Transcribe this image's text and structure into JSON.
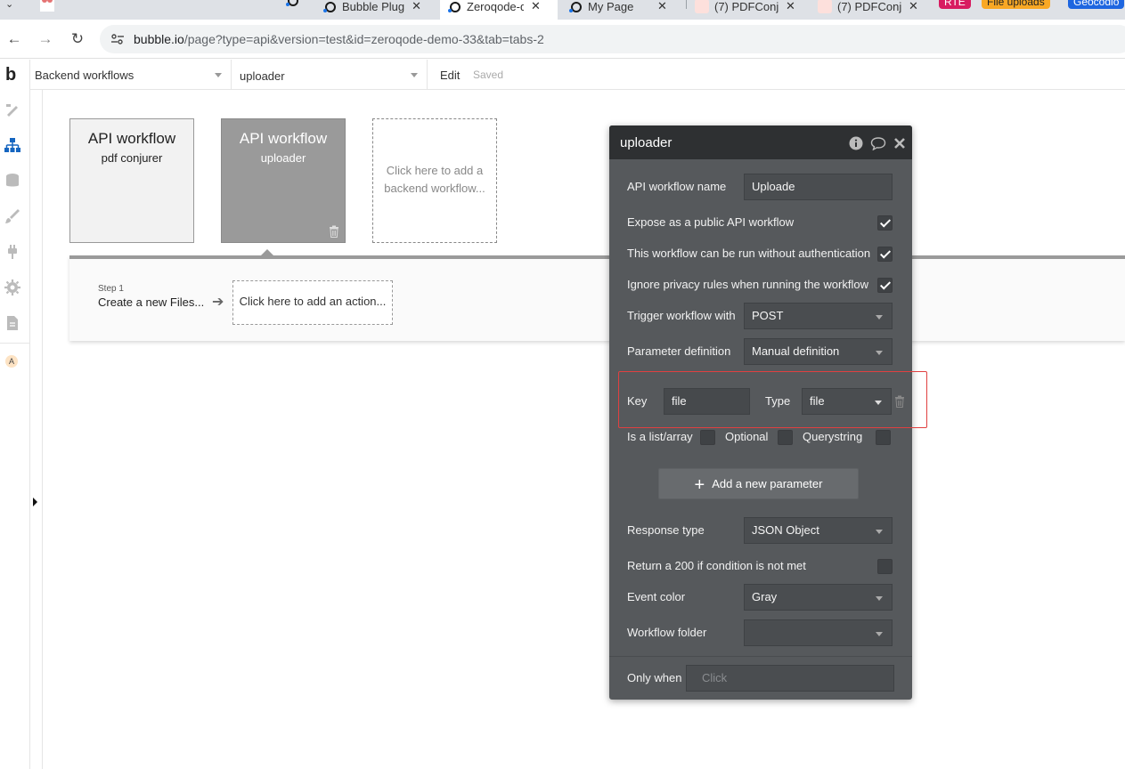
{
  "browser": {
    "tabs": [
      {
        "title": "Bubble Plug",
        "color": "#1a73e8"
      },
      {
        "title": "Zeroqode-d",
        "color": "#1a73e8"
      },
      {
        "title": "My Page",
        "color": "#1a73e8"
      },
      {
        "title": "(7) PDFConj",
        "color": "#c62828"
      },
      {
        "title": "(7) PDFConj",
        "color": "#c62828"
      }
    ],
    "pills": [
      {
        "label": "RTE",
        "bg": "#d81b60",
        "fg": "#ffffff"
      },
      {
        "label": "File uploads",
        "bg": "#f9a825",
        "fg": "#222222"
      },
      {
        "label": "Geocodio",
        "bg": "#1e66e0",
        "fg": "#ffffff"
      }
    ],
    "url_host": "bubble.io",
    "url_path": "/page?type=api&version=test&id=zeroqode-demo-33&tab=tabs-2"
  },
  "rail": {
    "logo": "b",
    "avatar_letter": "A"
  },
  "toolbar": {
    "page_select": "Backend workflows",
    "workflow_select": "uploader",
    "edit_label": "Edit",
    "saved_label": "Saved"
  },
  "canvas": {
    "cards": [
      {
        "title": "API workflow",
        "subtitle": "pdf conjurer"
      },
      {
        "title": "API workflow",
        "subtitle": "uploader"
      }
    ],
    "add_card_text": "Click here to add a backend workflow...",
    "step_label": "Step 1",
    "step_text": "Create a new Files...",
    "add_action_text": "Click here to add an action..."
  },
  "panel": {
    "title": "uploader",
    "api_name_label": "API workflow name",
    "api_name_value": "Uploade",
    "expose_label": "Expose as a public API workflow",
    "expose_checked": true,
    "noauth_label": "This workflow can be run without authentication",
    "noauth_checked": true,
    "privacy_label": "Ignore privacy rules when running the workflow",
    "privacy_checked": true,
    "trigger_label": "Trigger workflow with",
    "trigger_value": "POST",
    "paramdef_label": "Parameter definition",
    "paramdef_value": "Manual definition",
    "key_label": "Key",
    "key_value": "file",
    "type_label": "Type",
    "type_value": "file",
    "islist_label": "Is a list/array",
    "optional_label": "Optional",
    "querystring_label": "Querystring",
    "add_param_label": "Add a new parameter",
    "response_label": "Response type",
    "response_value": "JSON Object",
    "return200_label": "Return a 200 if condition is not met",
    "return200_checked": false,
    "eventcolor_label": "Event color",
    "eventcolor_value": "Gray",
    "folder_label": "Workflow folder",
    "folder_value": "",
    "onlywhen_label": "Only when",
    "onlywhen_placeholder": "Click"
  },
  "colors": {
    "panel_bg": "#56595c",
    "panel_header": "#2e3032",
    "highlight": "#e04040",
    "card_selected": "#9a9a9a"
  }
}
